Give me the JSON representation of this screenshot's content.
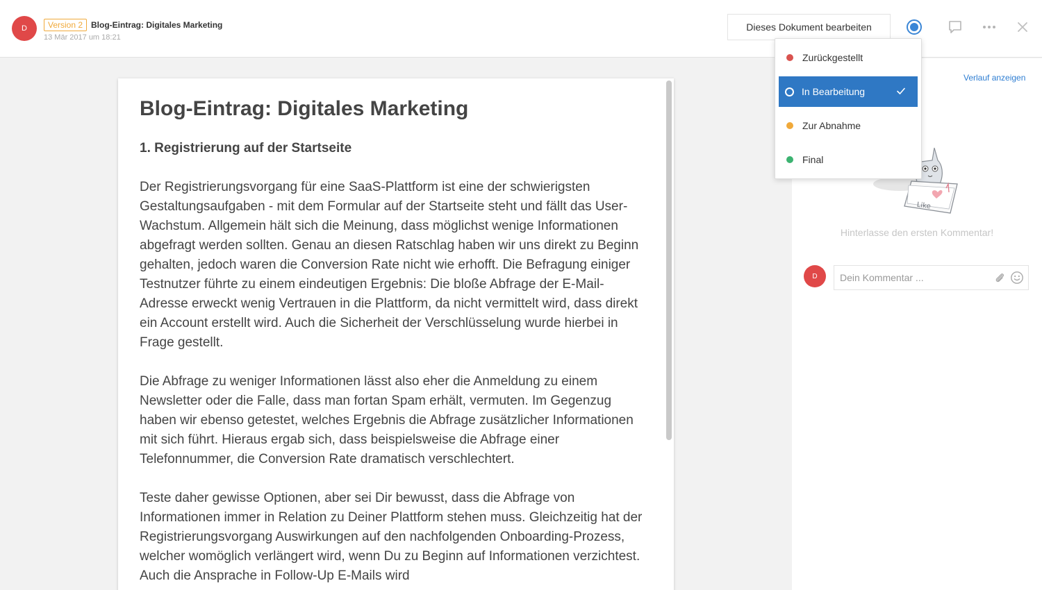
{
  "header": {
    "avatar_initial": "D",
    "version_label": "Version 2",
    "document_title": "Blog-Eintrag: Digitales Marketing",
    "timestamp": "13 Mär 2017 um 18:21",
    "edit_button_label": "Dieses Dokument bearbeiten",
    "current_status_color": "#3a86d6",
    "icons": [
      "status-dot-icon",
      "comment-icon",
      "more-icon",
      "close-icon"
    ]
  },
  "status_menu": {
    "items": [
      {
        "label": "Zurückgestellt",
        "color": "#d9534f",
        "selected": false
      },
      {
        "label": "In Bearbeitung",
        "color": "#2f78c4",
        "selected": true
      },
      {
        "label": "Zur Abnahme",
        "color": "#f0a93a",
        "selected": false
      },
      {
        "label": "Final",
        "color": "#3cb371",
        "selected": false
      }
    ]
  },
  "document": {
    "title": "Blog-Eintrag: Digitales Marketing",
    "heading": "1. Registrierung auf der Startseite",
    "paragraphs": [
      "Der Registrierungsvorgang für eine SaaS-Plattform ist eine der schwierigsten Gestaltungsaufgaben - mit dem Formular auf der Startseite steht und fällt das User-Wachstum. Allgemein hält sich die Meinung, dass möglichst wenige Informationen abgefragt werden sollten. Genau an diesen Ratschlag haben wir uns direkt zu Beginn gehalten, jedoch waren die Conversion Rate nicht wie erhofft. Die Befragung einiger Testnutzer führte zu einem eindeutigen Ergebnis: Die bloße Abfrage der E-Mail-Adresse erweckt wenig Vertrauen in die Plattform, da nicht vermittelt wird, dass direkt ein Account erstellt wird. Auch die Sicherheit der Verschlüsselung wurde hierbei in Frage gestellt.",
      "Die Abfrage zu weniger Informationen lässt also eher die Anmeldung zu einem Newsletter oder die Falle, dass man fortan Spam erhält, vermuten. Im Gegenzug haben wir ebenso getestet, welches Ergebnis die Abfrage zusätzlicher Informationen mit sich führt. Hieraus ergab sich, dass beispielsweise die Abfrage einer Telefonnummer, die Conversion Rate dramatisch verschlechtert.",
      "Teste daher gewisse Optionen, aber sei Dir bewusst, dass die Abfrage von Informationen immer in Relation zu Deiner Plattform stehen muss. Gleichzeitig hat der Registrierungsvorgang Auswirkungen auf den nachfolgenden Onboarding-Prozess, welcher womöglich verlängert wird, wenn Du zu Beginn auf Informationen verzichtest. Auch die Ansprache in Follow-Up E-Mails wird"
    ]
  },
  "comments": {
    "history_link": "Verlauf anzeigen",
    "empty_message": "Hinterlasse den ersten Kommentar!",
    "avatar_initial": "D",
    "input_placeholder": "Dein Kommentar ...",
    "illustration_text": "Like",
    "icons": [
      "attach-icon",
      "emoji-icon",
      "cat-illustration"
    ]
  },
  "colors": {
    "accent": "#2f78c4",
    "avatar": "#e04848",
    "version_badge": "#f0a93a"
  }
}
